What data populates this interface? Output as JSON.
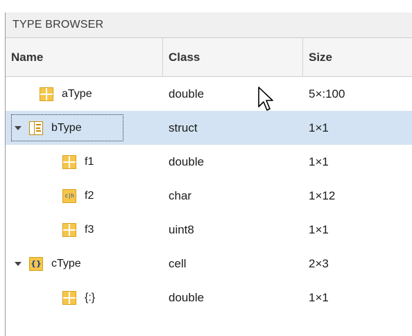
{
  "panel": {
    "title": "TYPE BROWSER"
  },
  "columns": {
    "name": "Name",
    "class": "Class",
    "size": "Size"
  },
  "rows": [
    {
      "name": "aType",
      "class": "double",
      "size": "5×:100",
      "icon": "grid-icon",
      "expand": "none",
      "selected": false
    },
    {
      "name": "bType",
      "class": "struct",
      "size": "1×1",
      "icon": "struct-icon",
      "expand": "expanded",
      "selected": true
    },
    {
      "name": "f1",
      "class": "double",
      "size": "1×1",
      "icon": "grid-icon",
      "expand": "none",
      "selected": false
    },
    {
      "name": "f2",
      "class": "char",
      "size": "1×12",
      "icon": "char-icon",
      "expand": "none",
      "selected": false
    },
    {
      "name": "f3",
      "class": "uint8",
      "size": "1×1",
      "icon": "grid-icon",
      "expand": "none",
      "selected": false
    },
    {
      "name": "cType",
      "class": "cell",
      "size": "2×3",
      "icon": "cell-icon",
      "expand": "expanded",
      "selected": false
    },
    {
      "name": "{:}",
      "class": "double",
      "size": "1×1",
      "icon": "grid-icon",
      "expand": "none",
      "selected": false
    }
  ],
  "icons": {
    "char_glyph": "c|h",
    "cell_glyph": "{}"
  },
  "colors": {
    "selection": "#d3e3f3",
    "icon_fill": "#f6c64a"
  }
}
